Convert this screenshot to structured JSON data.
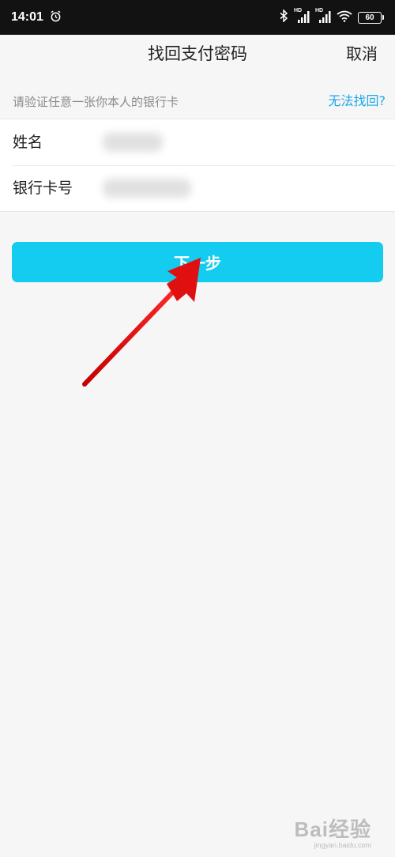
{
  "status_bar": {
    "time": "14:01",
    "network_label": "HD",
    "battery": "60"
  },
  "nav": {
    "title": "找回支付密码",
    "cancel_label": "取消"
  },
  "hint": {
    "text": "请验证任意一张你本人的银行卡",
    "link": "无法找回?"
  },
  "form": {
    "name_label": "姓名",
    "card_label": "银行卡号"
  },
  "primary_button": {
    "label": "下一步"
  },
  "watermark": {
    "main": "Bai经验",
    "sub": "jingyan.baidu.com"
  },
  "colors": {
    "accent": "#14cbf0",
    "link": "#1aa7e8",
    "background": "#f6f6f6",
    "annotation_arrow": "#e01010"
  }
}
